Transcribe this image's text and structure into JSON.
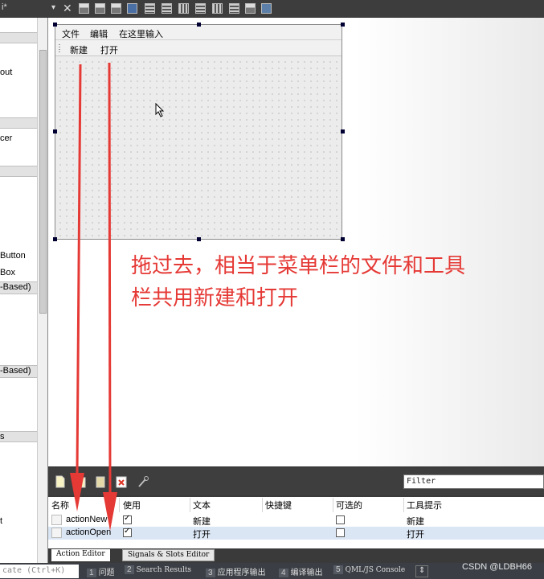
{
  "toolbar": {
    "title_fragment": "i*",
    "icons": [
      "layout-horizontal-icon",
      "layout-vertical-icon",
      "edit-buddies-icon",
      "edit-tab-order-icon",
      "lay-out-horizontally-icon",
      "lay-out-vertically-icon",
      "lay-out-splitter-h-icon",
      "lay-out-splitter-v-icon",
      "lay-out-grid-icon",
      "lay-out-form-icon",
      "break-layout-icon",
      "adjust-size-icon"
    ]
  },
  "left_panel": {
    "fragments": [
      {
        "text": "out"
      },
      {
        "text": "cer"
      },
      {
        "text": "Button"
      },
      {
        "text": "Box"
      },
      {
        "text": "-Based)"
      },
      {
        "text": "-Based)"
      },
      {
        "text": "s"
      },
      {
        "text": "t"
      }
    ]
  },
  "form": {
    "menubar": [
      "文件",
      "编辑",
      "在这里输入"
    ],
    "toolbar": [
      "新建",
      "打开"
    ]
  },
  "annotation": {
    "line1": "拖过去，相当于菜单栏的文件和工具",
    "line2": "栏共用新建和打开",
    "color": "#e53935"
  },
  "action_editor": {
    "filter_placeholder": "Filter",
    "columns": [
      "名称",
      "使用",
      "文本",
      "快捷键",
      "可选的",
      "工具提示"
    ],
    "rows": [
      {
        "name": "actionNew",
        "used": true,
        "text": "新建",
        "shortcut": "",
        "checkable": false,
        "tooltip": "新建"
      },
      {
        "name": "actionOpen",
        "used": true,
        "text": "打开",
        "shortcut": "",
        "checkable": false,
        "tooltip": "打开"
      }
    ],
    "tabs": [
      "Action Editor",
      "Signals & Slots Editor"
    ]
  },
  "statusbar": {
    "locate_placeholder": "cate (Ctrl+K)",
    "items": [
      {
        "num": "1",
        "label": "问题"
      },
      {
        "num": "2",
        "label": "Search Results"
      },
      {
        "num": "3",
        "label": "应用程序输出"
      },
      {
        "num": "4",
        "label": "编译输出"
      },
      {
        "num": "5",
        "label": "QML/JS Console"
      }
    ]
  },
  "watermark": "CSDN @LDBH66"
}
